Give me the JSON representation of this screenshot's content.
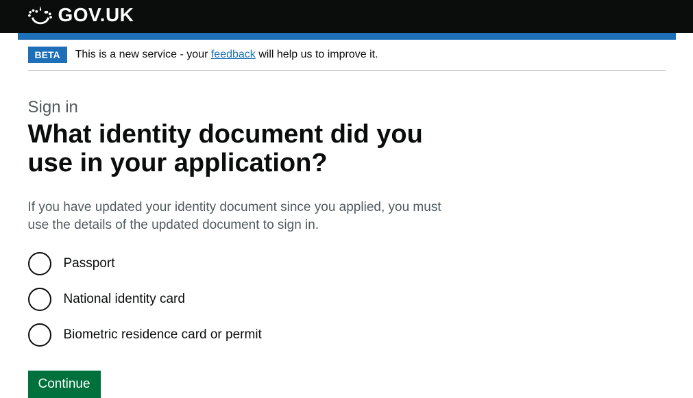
{
  "header": {
    "logo_text": "GOV.UK"
  },
  "phase_banner": {
    "tag": "BETA",
    "text_before": "This is a new service - your ",
    "link_text": "feedback",
    "text_after": " will help us to improve it."
  },
  "page": {
    "caption": "Sign in",
    "heading": "What identity document did you use in your application?",
    "hint": "If you have updated your identity document since you applied, you must use the details of the updated document to sign in."
  },
  "radios": {
    "options": [
      {
        "label": "Passport"
      },
      {
        "label": "National identity card"
      },
      {
        "label": "Biometric residence card or permit"
      }
    ]
  },
  "button": {
    "continue": "Continue"
  }
}
